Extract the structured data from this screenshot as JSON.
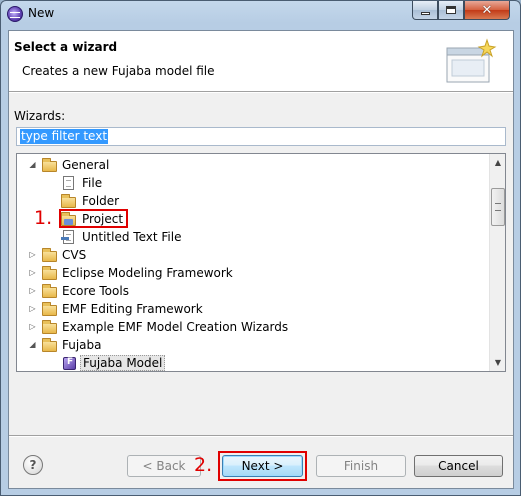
{
  "window": {
    "title": "New"
  },
  "header": {
    "title": "Select a wizard",
    "description": "Creates a new Fujaba model file"
  },
  "wizards_label": "Wizards:",
  "filter": {
    "value": "type filter text"
  },
  "tree": {
    "rows": [
      {
        "label": "General",
        "level": 0,
        "expanded": true,
        "icon": "folder-icon"
      },
      {
        "label": "File",
        "level": 1,
        "icon": "file-icon"
      },
      {
        "label": "Folder",
        "level": 1,
        "icon": "folder-icon"
      },
      {
        "label": "Project",
        "level": 1,
        "icon": "project-icon"
      },
      {
        "label": "Untitled Text File",
        "level": 1,
        "icon": "text-file-icon"
      },
      {
        "label": "CVS",
        "level": 0,
        "expanded": false,
        "icon": "folder-icon"
      },
      {
        "label": "Eclipse Modeling Framework",
        "level": 0,
        "expanded": false,
        "icon": "folder-icon"
      },
      {
        "label": "Ecore Tools",
        "level": 0,
        "expanded": false,
        "icon": "folder-icon"
      },
      {
        "label": "EMF Editing Framework",
        "level": 0,
        "expanded": false,
        "icon": "folder-icon"
      },
      {
        "label": "Example EMF Model Creation Wizards",
        "level": 0,
        "expanded": false,
        "icon": "folder-icon"
      },
      {
        "label": "Fujaba",
        "level": 0,
        "expanded": true,
        "icon": "folder-icon"
      },
      {
        "label": "Fujaba Model",
        "level": 1,
        "icon": "fujaba-icon",
        "selected": true
      }
    ]
  },
  "buttons": {
    "help": "?",
    "back": "< Back",
    "next": "Next >",
    "finish": "Finish",
    "cancel": "Cancel"
  },
  "annotations": {
    "step1": "1.",
    "step2": "2."
  },
  "colors": {
    "annotation": "#e00000",
    "selection": "#3399ff"
  }
}
